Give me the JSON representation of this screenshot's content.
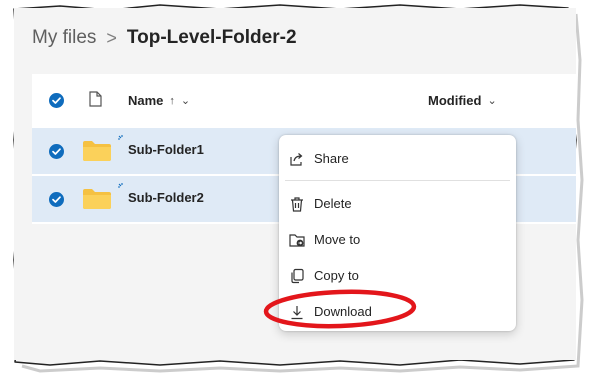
{
  "breadcrumb": {
    "root": "My files",
    "separator": ">",
    "current": "Top-Level-Folder-2"
  },
  "list": {
    "columns": {
      "name": "Name",
      "name_sort": "↑",
      "name_menu": "⌄",
      "modified": "Modified",
      "modified_menu": "⌄"
    },
    "rows": [
      {
        "name": "Sub-Folder1",
        "selected": true
      },
      {
        "name": "Sub-Folder2",
        "selected": true
      }
    ]
  },
  "context_menu": {
    "items": [
      {
        "label": "Share",
        "icon": "share-icon"
      },
      {
        "label": "Delete",
        "icon": "trash-icon"
      },
      {
        "label": "Move to",
        "icon": "move-folder-icon"
      },
      {
        "label": "Copy to",
        "icon": "copy-icon"
      },
      {
        "label": "Download",
        "icon": "download-icon"
      }
    ]
  },
  "colors": {
    "accent": "#0f6cbd",
    "selected_row": "#dfeaf6",
    "folder": "#f5c142",
    "highlight": "#e3161b"
  }
}
